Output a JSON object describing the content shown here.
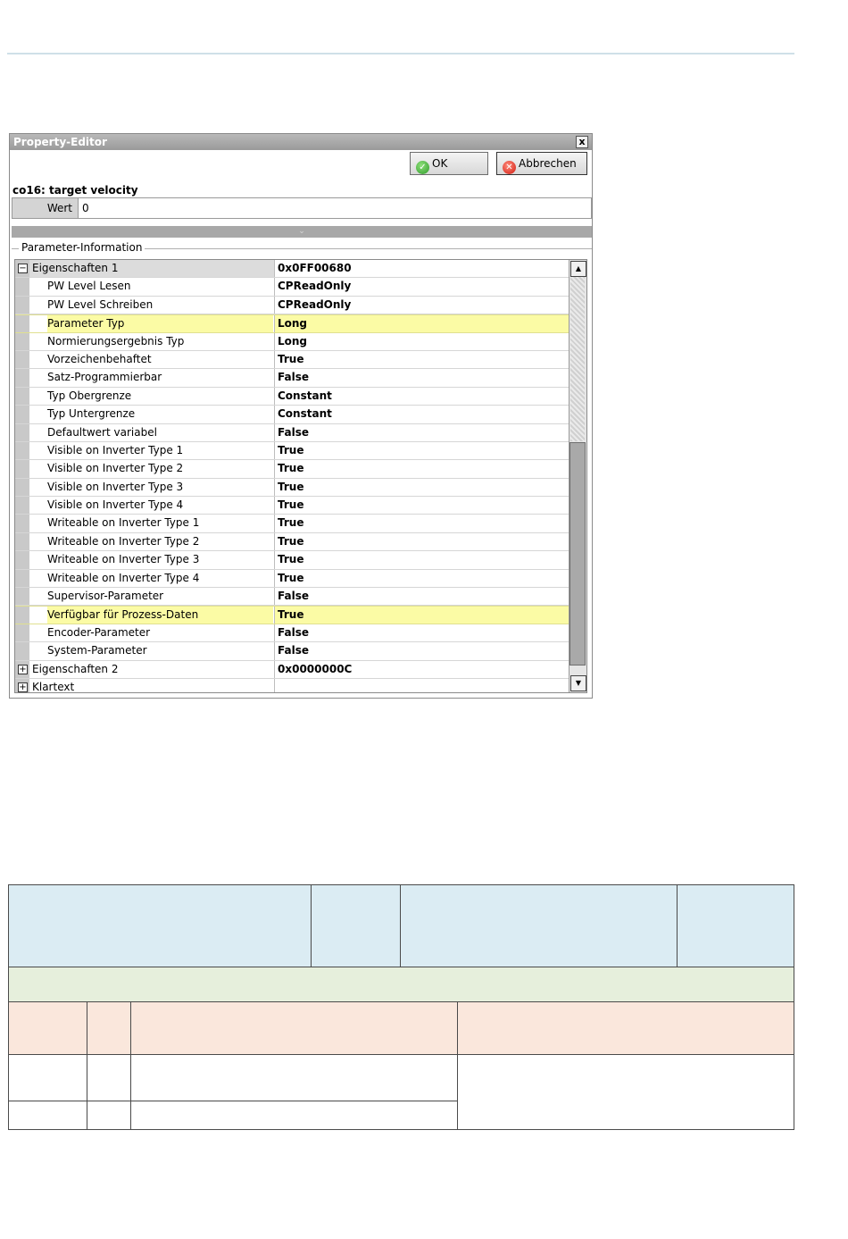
{
  "window": {
    "title": "Property-Editor",
    "close_glyph": "x",
    "ok_label": "OK",
    "cancel_label": "Abbrechen"
  },
  "parameter": {
    "name": "co16: target velocity",
    "value_label": "Wert",
    "value": "0"
  },
  "splitter_glyph": "⌄",
  "group_label": "Parameter-Information",
  "rows": [
    {
      "name": "Eigenschaften 1",
      "value": "0x0FF00680",
      "group": true,
      "expanded": true
    },
    {
      "name": "PW Level Lesen",
      "value": "CPReadOnly"
    },
    {
      "name": "PW Level Schreiben",
      "value": "CPReadOnly"
    },
    {
      "name": "Parameter Typ",
      "value": "Long",
      "highlight": true
    },
    {
      "name": "Normierungsergebnis Typ",
      "value": "Long"
    },
    {
      "name": "Vorzeichenbehaftet",
      "value": "True"
    },
    {
      "name": "Satz-Programmierbar",
      "value": "False"
    },
    {
      "name": "Typ Obergrenze",
      "value": "Constant"
    },
    {
      "name": "Typ Untergrenze",
      "value": "Constant"
    },
    {
      "name": "Defaultwert variabel",
      "value": "False"
    },
    {
      "name": "Visible on Inverter Type 1",
      "value": "True"
    },
    {
      "name": "Visible on Inverter Type 2",
      "value": "True"
    },
    {
      "name": "Visible on Inverter Type 3",
      "value": "True"
    },
    {
      "name": "Visible on Inverter Type 4",
      "value": "True"
    },
    {
      "name": "Writeable on Inverter Type 1",
      "value": "True"
    },
    {
      "name": "Writeable on Inverter Type 2",
      "value": "True"
    },
    {
      "name": "Writeable on Inverter Type 3",
      "value": "True"
    },
    {
      "name": "Writeable on Inverter Type 4",
      "value": "True"
    },
    {
      "name": "Supervisor-Parameter",
      "value": "False"
    },
    {
      "name": "Verfügbar für Prozess-Daten",
      "value": "True",
      "highlight": true
    },
    {
      "name": "Encoder-Parameter",
      "value": "False"
    },
    {
      "name": "System-Parameter",
      "value": "False"
    },
    {
      "name": "Eigenschaften 2",
      "value": "0x0000000C",
      "group": true,
      "expanded": false
    },
    {
      "name": "Klartext",
      "value": "",
      "group": true,
      "expanded": false
    }
  ],
  "colors": {
    "highlight": "#fbfba5",
    "table_header": "#dbecf3",
    "table_band": "#e6efdc",
    "table_subheader": "#fae7dc"
  }
}
